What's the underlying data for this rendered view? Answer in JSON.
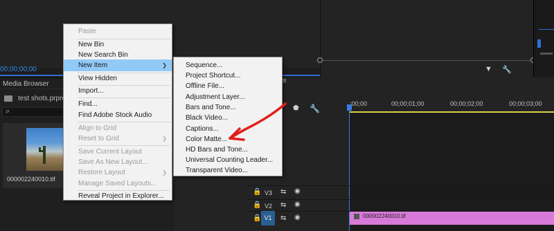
{
  "timecode": "00;00;00;00",
  "project_panel": {
    "tab_label": "Media Browser",
    "project_name": "test shots.prproj",
    "clip_thumbnail_label": "000002240010.tif"
  },
  "timeline": {
    "ruler_labels": [
      ":00;00",
      "00;00;01;00",
      "00;00;02;00",
      "00;00;03;00"
    ],
    "tracks": [
      {
        "name": "V3"
      },
      {
        "name": "V2"
      },
      {
        "name": "V1"
      }
    ],
    "clip_label": "000002240010.tif"
  },
  "context_menu": {
    "items": [
      {
        "label": "Paste",
        "disabled": true
      },
      {
        "label": "New Bin",
        "disabled": false
      },
      {
        "label": "New Search Bin",
        "disabled": false
      },
      {
        "label": "New Item",
        "disabled": false,
        "submenu": true,
        "highlighted": true
      },
      {
        "label": "View Hidden",
        "disabled": false
      },
      {
        "label": "Import...",
        "disabled": false
      },
      {
        "label": "Find...",
        "disabled": false
      },
      {
        "label": "Find Adobe Stock Audio",
        "disabled": false
      },
      {
        "label": "Align to Grid",
        "disabled": true
      },
      {
        "label": "Reset to Grid",
        "disabled": true,
        "submenu": true
      },
      {
        "label": "Save Current Layout",
        "disabled": true
      },
      {
        "label": "Save As New Layout...",
        "disabled": true
      },
      {
        "label": "Restore Layout",
        "disabled": true,
        "submenu": true
      },
      {
        "label": "Manage Saved Layouts...",
        "disabled": true
      },
      {
        "label": "Reveal Project in Explorer...",
        "disabled": false
      }
    ]
  },
  "new_item_submenu": {
    "items": [
      {
        "label": "Sequence..."
      },
      {
        "label": "Project Shortcut..."
      },
      {
        "label": "Offline File..."
      },
      {
        "label": "Adjustment Layer..."
      },
      {
        "label": "Bars and Tone..."
      },
      {
        "label": "Black Video..."
      },
      {
        "label": "Captions..."
      },
      {
        "label": "Color Matte..."
      },
      {
        "label": "HD Bars and Tone..."
      },
      {
        "label": "Universal Counting Leader..."
      },
      {
        "label": "Transparent Video..."
      }
    ]
  },
  "colors": {
    "menu_highlight": "#91c9f7",
    "annotation_arrow": "#e0201c",
    "clip": "#d87ad9",
    "playhead": "#3a7be0",
    "timecode": "#2d8ceb"
  },
  "submenu_arrow_glyph": "❯"
}
